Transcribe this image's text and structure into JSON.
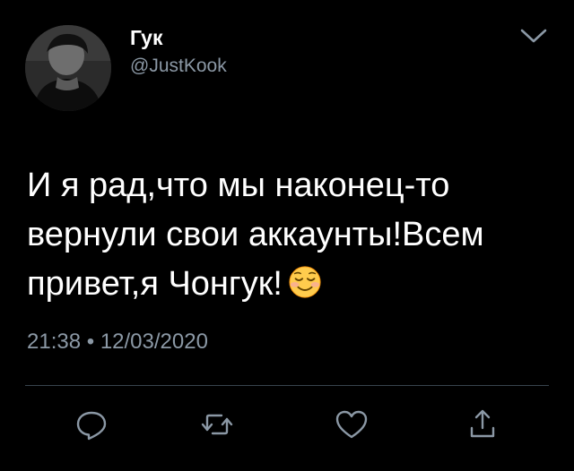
{
  "author": {
    "display_name": "Гук",
    "handle": "@JustKook"
  },
  "tweet": {
    "text": "И я рад,что мы наконец-то\nвернули свои аккаунты!Всем\nпривет,я Чонгук!",
    "emoji": "smiling-face-icon",
    "time": "21:38",
    "separator": "•",
    "date": "12/03/2020"
  },
  "actions": [
    {
      "icon": "reply-icon"
    },
    {
      "icon": "retweet-icon"
    },
    {
      "icon": "like-icon"
    },
    {
      "icon": "share-icon"
    }
  ],
  "colors": {
    "background": "#000000",
    "text": "#ffffff",
    "secondary_text": "#8b98a5",
    "divider": "#38444d"
  }
}
